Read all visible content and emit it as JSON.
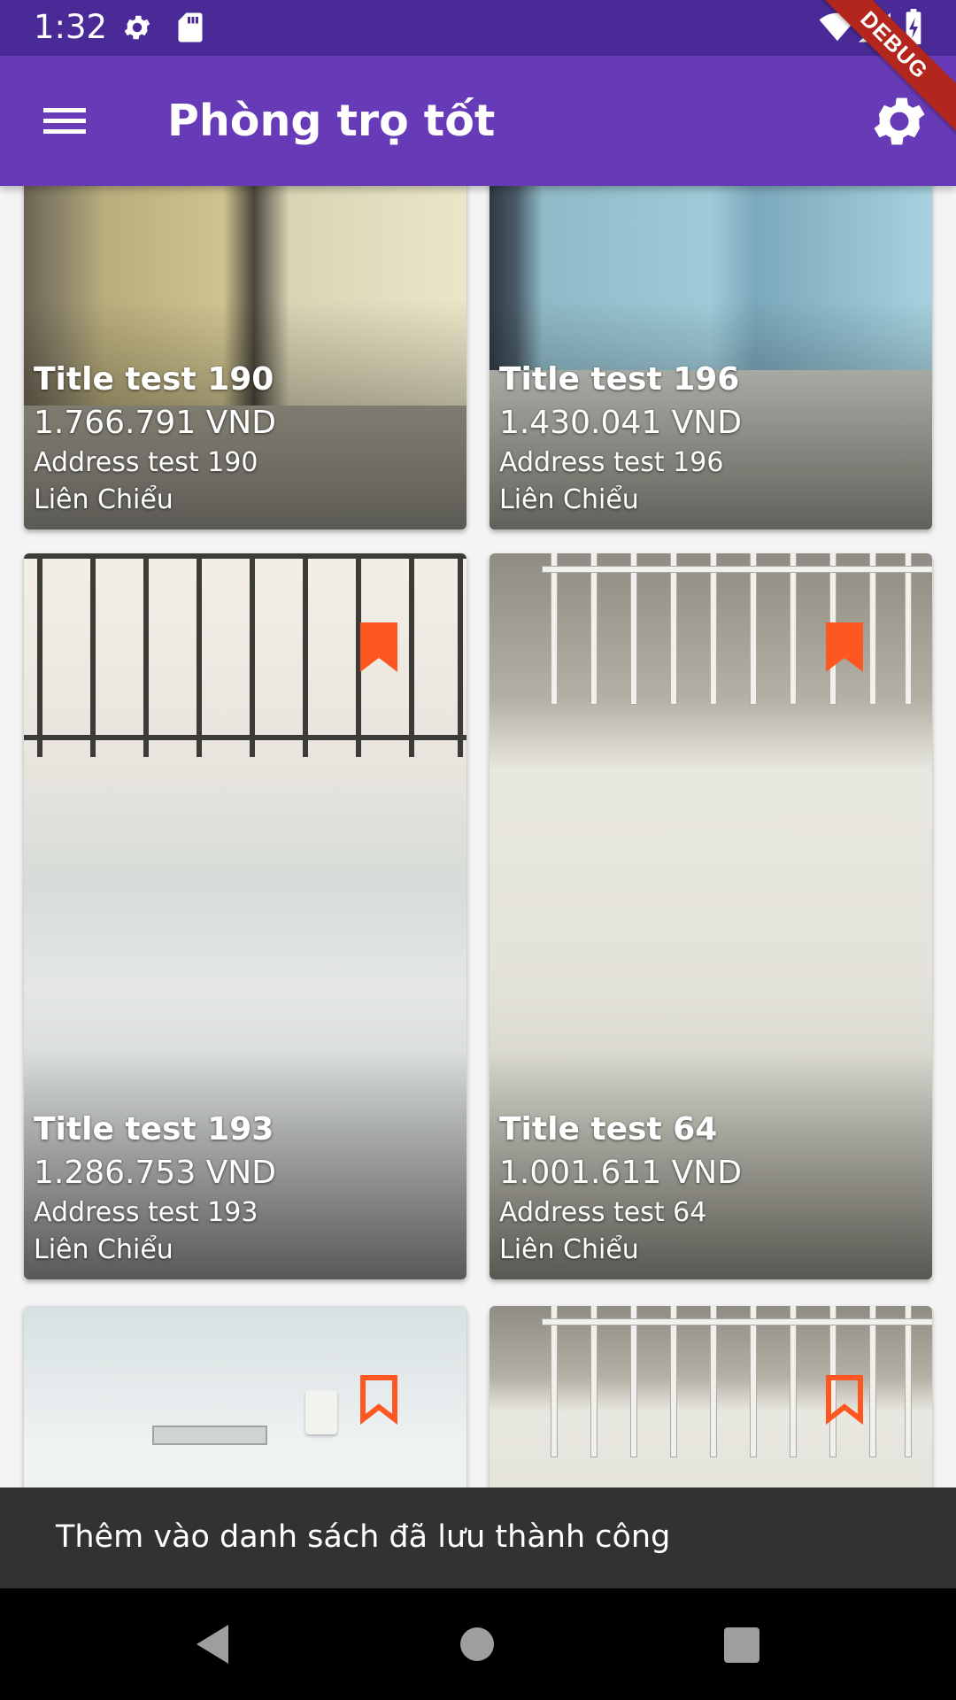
{
  "status_bar": {
    "time": "1:32",
    "icons": [
      "settings-icon",
      "sd-card-icon",
      "wifi-icon",
      "signal-icon",
      "battery-charging-icon"
    ]
  },
  "debug_ribbon": "DEBUG",
  "app_bar": {
    "title": "Phòng trọ tốt",
    "background": "#673ab7",
    "menu_icon": "menu-icon",
    "settings_icon": "gear-icon"
  },
  "listings": [
    {
      "title": "Title test 190",
      "price": "1.766.791 VND",
      "address": "Address test 190",
      "district": "Liên Chiểu",
      "bookmarked": null
    },
    {
      "title": "Title test 196",
      "price": "1.430.041 VND",
      "address": "Address test 196",
      "district": "Liên Chiểu",
      "bookmarked": null
    },
    {
      "title": "Title test 193",
      "price": "1.286.753 VND",
      "address": "Address test 193",
      "district": "Liên Chiểu",
      "bookmarked": true
    },
    {
      "title": "Title test 64",
      "price": "1.001.611 VND",
      "address": "Address test 64",
      "district": "Liên Chiểu",
      "bookmarked": true
    },
    {
      "title": "",
      "price": "",
      "address": "",
      "district": "",
      "bookmarked": false
    },
    {
      "title": "",
      "price": "",
      "address": "",
      "district": "",
      "bookmarked": false
    }
  ],
  "bookmark_color": "#ff5722",
  "snackbar": {
    "message": "Thêm vào danh sách đã lưu thành công"
  },
  "nav_bar": {
    "icons": [
      "back-icon",
      "home-icon",
      "recents-icon"
    ]
  }
}
